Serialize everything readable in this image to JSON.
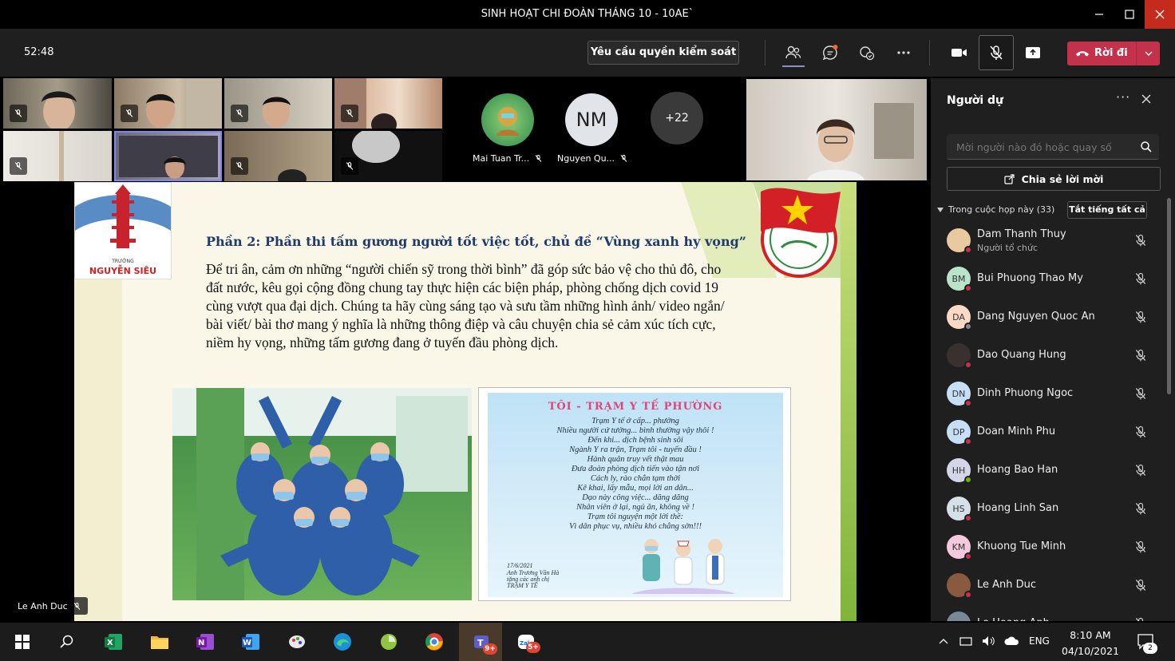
{
  "window": {
    "title": "SINH HOẠT CHI ĐOÀN THÁNG 10 - 10AE`"
  },
  "toolbar": {
    "timer": "52:48",
    "request_control": "Yêu cầu quyền kiểm soát",
    "leave": "Rời đi"
  },
  "strip": {
    "avatars": [
      {
        "name": "Mai Tuan Tr...",
        "initials": ""
      },
      {
        "name": "Nguyen Qu...",
        "initials": "NM"
      },
      {
        "name": "",
        "initials": "+22"
      }
    ]
  },
  "slide": {
    "school_line1": "TRƯỜNG",
    "school_line2": "NGUYỄN SIÊU",
    "heading": "Phần 2: Phần thi tấm gương người tốt việc tốt, chủ đề “Vùng xanh hy vọng”",
    "body": "Để tri ân, cảm ơn những “người chiến sỹ trong thời bình” đã góp sức bảo vệ cho thủ đô, cho đất nước, kêu gọi cộng đồng chung tay thực hiện các biện pháp, phòng chống dịch covid 19 cùng vượt qua đại dịch. Chúng ta hãy cùng sáng tạo và sưu tầm những hình ảnh/ video ngắn/ bài viết/ bài thơ mang ý nghĩa là những thông điệp và câu chuyện chia sẻ cảm xúc tích cực, niềm hy vọng, những tấm gương đang ở tuyến đầu phòng dịch.",
    "poem_title": "TÔI - TRẠM Y TẾ PHƯỜNG",
    "poem_lines": [
      "Trạm Y tế ở cấp... phường",
      "Nhiều người cứ tưởng... bình thường vậy thôi !",
      "Đến khi... dịch bệnh sinh sôi",
      "Ngành Y ra trận, Trạm tôi - tuyến đầu !",
      "Hành quân truy vết thật mau",
      "Đưa đoàn phòng dịch tiến vào tận nơi",
      "Cách ly, rào chắn tạm thời",
      "Kê khai, lấy mẫu, mọi lời an dân...",
      "Dạo này công việc... dăng dăng",
      "Nhân viên ở lại, ngủ ăn, không về !",
      "Trạm tôi nguyện một lời thề:",
      "Vì dân phục vụ, nhiều khó chẳng sờn!!!"
    ],
    "poem_date": "17/6/2021",
    "poem_sign1": "Anh Trương Văn Hà",
    "poem_sign2": "tặng các anh chị",
    "poem_sign3": "TRẠM Y TẾ",
    "presenter": "Le Anh Duc"
  },
  "panel": {
    "title": "Người dự",
    "search_placeholder": "Mời người nào đó hoặc quay số",
    "share": "Chia sẻ lời mời",
    "section": "Trong cuộc họp này (33)",
    "mute_all": "Tắt tiếng tất cả",
    "participants": [
      {
        "name": "Dam Thanh Thuy",
        "role": "Người tổ chức",
        "initials": "",
        "color": "#e8c9a0",
        "status": "#c4314b"
      },
      {
        "name": "Bui Phuong Thao My",
        "role": "",
        "initials": "BM",
        "color": "#b9e4c9",
        "status": "#c4314b"
      },
      {
        "name": "Dang Nguyen Quoc An",
        "role": "",
        "initials": "DA",
        "color": "#fbd9c4",
        "status": "#888888"
      },
      {
        "name": "Dao Quang Hung",
        "role": "",
        "initials": "",
        "color": "#3a3030",
        "status": "#c4314b"
      },
      {
        "name": "Dinh Phuong Ngoc",
        "role": "",
        "initials": "DN",
        "color": "#c6dff5",
        "status": "#c4314b"
      },
      {
        "name": "Doan Minh Phu",
        "role": "",
        "initials": "DP",
        "color": "#c6dff5",
        "status": "#c4314b"
      },
      {
        "name": "Hoang Bao Han",
        "role": "",
        "initials": "HH",
        "color": "#d5d5e8",
        "status": "#6bb700"
      },
      {
        "name": "Hoang Linh San",
        "role": "",
        "initials": "HS",
        "color": "#d5e0e8",
        "status": "#c4314b"
      },
      {
        "name": "Khuong Tue Minh",
        "role": "",
        "initials": "KM",
        "color": "#f3c9e0",
        "status": "#c4314b"
      },
      {
        "name": "Le Anh Duc",
        "role": "",
        "initials": "",
        "color": "#8a5a40",
        "status": "#c4314b"
      },
      {
        "name": "Le Hoang Anh",
        "role": "",
        "initials": "",
        "color": "#778899",
        "status": "#c4314b"
      }
    ]
  },
  "taskbar": {
    "lang": "ENG",
    "time": "8:10 AM",
    "date": "04/10/2021",
    "teams_badge": "9+",
    "zalo_badge": "5+",
    "notif_count": "2"
  }
}
